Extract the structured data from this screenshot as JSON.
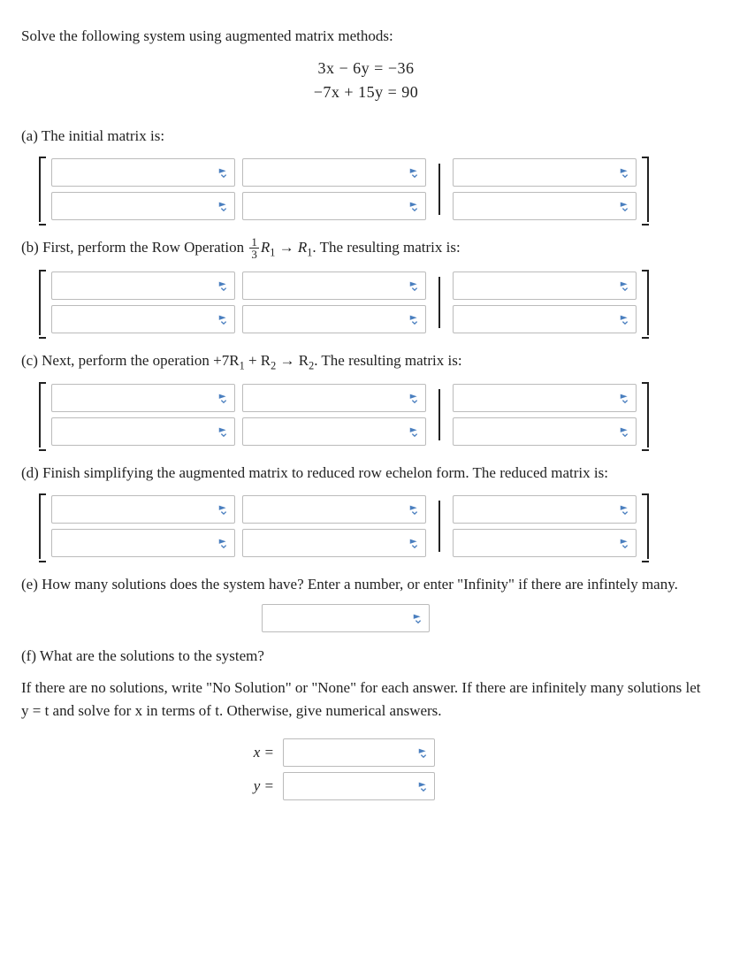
{
  "intro": "Solve the following system using augmented matrix methods:",
  "equations": {
    "line1": "3x − 6y = −36",
    "line2": "−7x + 15y = 90"
  },
  "parts": {
    "a": "(a) The initial matrix is:",
    "b_pre": "(b) First, perform the Row Operation ",
    "b_post": ". The resulting matrix is:",
    "b_op": {
      "frac_num": "1",
      "frac_den": "3",
      "r1a": "R",
      "r1a_sub": "1",
      "arrow": " → ",
      "r1b": "R",
      "r1b_sub": "1"
    },
    "c_pre": "(c) Next, perform the operation ",
    "c_mid": "+7R",
    "c_sub1": "1",
    "c_plus": " + R",
    "c_sub2": "2",
    "c_arrow": " → R",
    "c_sub3": "2",
    "c_post": ". The resulting matrix is:",
    "d": "(d) Finish simplifying the augmented matrix to reduced row echelon form. The reduced matrix is:",
    "e": "(e) How many solutions does the system have? Enter a number, or enter \"Infinity\" if there are infintely many.",
    "f": "(f) What are the solutions to the system?",
    "f_detail": "If there are no solutions, write \"No Solution\" or \"None\" for each answer. If there are infinitely many solutions let y = t and solve for x in terms of t. Otherwise, give numerical answers."
  },
  "labels": {
    "x_eq": "x =",
    "y_eq": "y ="
  },
  "matrices": {
    "a": [
      [
        "",
        "",
        ""
      ],
      [
        "",
        "",
        ""
      ]
    ],
    "b": [
      [
        "",
        "",
        ""
      ],
      [
        "",
        "",
        ""
      ]
    ],
    "c": [
      [
        "",
        "",
        ""
      ],
      [
        "",
        "",
        ""
      ]
    ],
    "d": [
      [
        "",
        "",
        ""
      ],
      [
        "",
        "",
        ""
      ]
    ]
  },
  "answers": {
    "num_solutions": "",
    "x": "",
    "y": ""
  }
}
